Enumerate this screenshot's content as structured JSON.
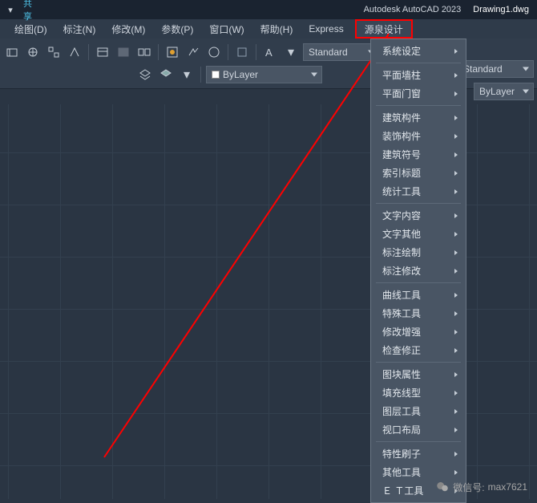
{
  "title": {
    "app": "Autodesk AutoCAD 2023",
    "file": "Drawing1.dwg",
    "share": "共享"
  },
  "menu": {
    "items": [
      "绘图(D)",
      "标注(N)",
      "修改(M)",
      "参数(P)",
      "窗口(W)",
      "帮助(H)",
      "Express"
    ],
    "active": "源泉设计"
  },
  "toolbar": {
    "style_combo": "Standard",
    "layer_combo": "ByLayer",
    "ghost_style": "Standard",
    "ghost_layer": "ByLayer"
  },
  "dropdown": {
    "groups": [
      [
        "系统设定"
      ],
      [
        "平面墙柱",
        "平面门窗"
      ],
      [
        "建筑构件",
        "装饰构件",
        "建筑符号",
        "索引标题",
        "统计工具"
      ],
      [
        "文字内容",
        "文字其他",
        "标注绘制",
        "标注修改"
      ],
      [
        "曲线工具",
        "特殊工具",
        "修改增强",
        "检查修正"
      ],
      [
        "图块属性",
        "填充线型",
        "图层工具",
        "视口布局"
      ],
      [
        "特性刷子",
        "其他工具",
        "Ｅ Ｔ工具"
      ]
    ]
  },
  "watermark": {
    "prefix": "微信号:",
    "id": "max7621"
  }
}
